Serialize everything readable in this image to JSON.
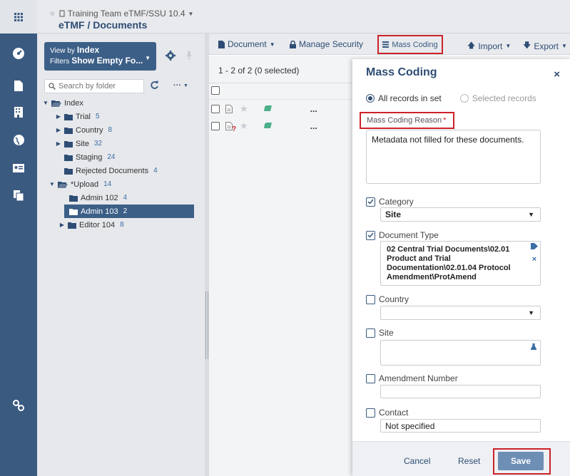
{
  "header": {
    "study_name": "Training Team eTMF/SSU 10.4",
    "breadcrumb": "eTMF / Documents"
  },
  "folder_panel": {
    "view_by_prefix": "View by",
    "view_by_value": "Index",
    "filters_prefix": "Filters",
    "filters_value": "Show Empty Fo...",
    "search_placeholder": "Search by folder",
    "tree": [
      {
        "label": "Index",
        "count": "",
        "expanded": true
      },
      {
        "label": "Trial",
        "count": "5"
      },
      {
        "label": "Country",
        "count": "8"
      },
      {
        "label": "Site",
        "count": "32"
      },
      {
        "label": "Staging",
        "count": "24"
      },
      {
        "label": "Rejected Documents",
        "count": "4"
      },
      {
        "label": "*Upload",
        "count": "14",
        "expanded": true
      },
      {
        "label": "Admin 102",
        "count": "4"
      },
      {
        "label": "Admin 103",
        "count": "2",
        "selected": true
      },
      {
        "label": "Editor 104",
        "count": "8"
      }
    ]
  },
  "toolbar": {
    "document": "Document",
    "manage_security": "Manage Security",
    "mass_coding": "Mass Coding",
    "import": "Import",
    "export": "Export"
  },
  "documents": {
    "count_text": "1 - 2 of 2 (0 selected)",
    "more": "..."
  },
  "modal": {
    "title": "Mass Coding",
    "close": "×",
    "radio_all": "All records in set",
    "radio_selected": "Selected records",
    "reason_label": "Mass Coding Reason",
    "required_mark": "*",
    "reason_value": "Metadata not filled for these documents.",
    "category_label": "Category",
    "category_value": "Site",
    "doctype_label": "Document Type",
    "doctype_value": "02 Central Trial Documents\\02.01 Product and Trial Documentation\\02.01.04  Protocol Amendment\\ProtAmend",
    "country_label": "Country",
    "country_value": "",
    "site_label": "Site",
    "amendment_label": "Amendment Number",
    "amendment_value": "",
    "contact_label": "Contact",
    "contact_value": "Not specified",
    "cancel": "Cancel",
    "reset": "Reset",
    "save": "Save"
  },
  "colors": {
    "nav": "#3a5a80",
    "accent": "#2e4d74",
    "highlight": "#cc2229",
    "save_button": "#6e8fb5"
  }
}
